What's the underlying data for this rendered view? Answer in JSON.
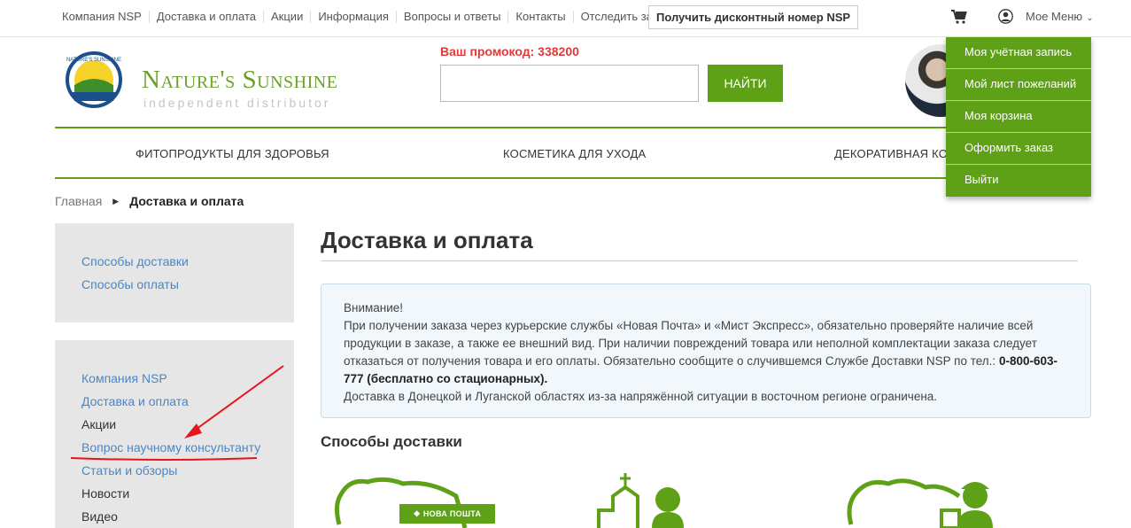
{
  "topbar": {
    "links": [
      "Компания NSP",
      "Доставка и оплата",
      "Акции",
      "Информация",
      "Вопросы и ответы",
      "Контакты",
      "Отследить заказ"
    ],
    "discount_button": "Получить дисконтный номер NSP",
    "my_menu": "Мое Меню"
  },
  "header": {
    "logo_text": "Nature's Sunshine",
    "logo_sub": "independent distributor",
    "promo": "Ваш промокод: 338200",
    "search_value": "",
    "search_button": "НАЙТИ"
  },
  "nav": {
    "items": [
      "ФИТОПРОДУКТЫ ДЛЯ ЗДОРОВЬЯ",
      "КОСМЕТИКА ДЛЯ УХОДА",
      "ДЕКОРАТИВНАЯ КО"
    ]
  },
  "dropdown": {
    "items": [
      "Моя учётная запись",
      "Мой лист пожеланий",
      "Моя корзина",
      "Оформить заказ",
      "Выйти"
    ]
  },
  "breadcrumb": {
    "home": "Главная",
    "current": "Доставка и оплата"
  },
  "sidebar": {
    "box1": [
      "Способы доставки",
      "Способы оплаты"
    ],
    "box2": [
      "Компания NSP",
      "Доставка и оплата",
      "Акции",
      "Вопрос научному консультанту",
      "Статьи и обзоры",
      "Новости",
      "Видео"
    ]
  },
  "main": {
    "title": "Доставка и оплата",
    "notice": {
      "line1": "Внимание!",
      "line2": "При получении заказа через курьерские службы «Новая Почта» и «Мист Экспресс», обязательно проверяйте наличие всей продукции в заказе, а также ее внешний вид. При наличии повреждений товара или неполной комплектации заказа следует отказаться от получения товара и его оплаты. Обязательно сообщите о случившемся Службе Доставки NSP по тел.:",
      "phone": "0-800-603-777 (бесплатно со стационарных).",
      "line3": "Доставка в Донецкой и Луганской областях из-за напряжённой ситуации в восточном регионе ограничена."
    },
    "section_title": "Способы доставки",
    "nova_poshta": "НОВА ПОШТА"
  },
  "colors": {
    "brand_green": "#5ea116",
    "link_blue": "#4a86c5",
    "promo_red": "#e0393b",
    "annotation_red": "#e8141c"
  }
}
